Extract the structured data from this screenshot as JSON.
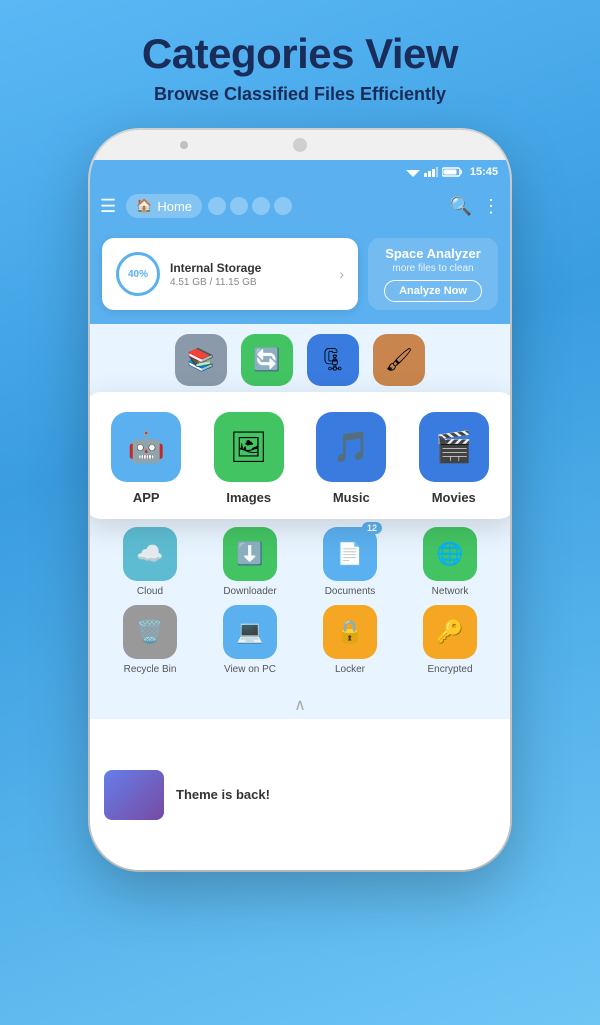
{
  "header": {
    "title": "Categories View",
    "subtitle": "Browse Classified Files Efficiently"
  },
  "statusBar": {
    "time": "15:45"
  },
  "navBar": {
    "homeLabel": "Home",
    "searchIcon": "search",
    "moreIcon": "more"
  },
  "storage": {
    "percent": "40%",
    "title": "Internal Storage",
    "size": "4.51 GB / 11.15 GB",
    "analyzer": {
      "title": "Space Analyzer",
      "subtitle": "more files to clean",
      "buttonLabel": "Analyze Now"
    }
  },
  "popupCategories": [
    {
      "label": "APP",
      "color": "#5bb0ef",
      "icon": "🤖"
    },
    {
      "label": "Images",
      "color": "#43c463",
      "icon": "🖼️"
    },
    {
      "label": "Music",
      "color": "#5bb0ef",
      "icon": "🎵"
    },
    {
      "label": "Movies",
      "color": "#5bb0ef",
      "icon": "🎬"
    }
  ],
  "bottomCategories": {
    "row1": [
      {
        "label": "Cloud",
        "color": "#5dbcd2",
        "icon": "☁️"
      },
      {
        "label": "Downloader",
        "color": "#43c463",
        "icon": "⬇️"
      },
      {
        "label": "Documents",
        "color": "#5bb0ef",
        "icon": "📄",
        "badge": "12"
      },
      {
        "label": "Network",
        "color": "#43c463",
        "icon": "🌐"
      }
    ],
    "row2": [
      {
        "label": "Recycle Bin",
        "color": "#999",
        "icon": "🗑️"
      },
      {
        "label": "View on PC",
        "color": "#5bb0ef",
        "icon": "🖥️"
      },
      {
        "label": "Locker",
        "color": "#f5a623",
        "icon": "🔒"
      },
      {
        "label": "Encrypted",
        "color": "#f5a623",
        "icon": "🔑"
      }
    ]
  },
  "topPartialIcons": [
    {
      "color": "#8a9aaa",
      "icon": "📚"
    },
    {
      "color": "#43c463",
      "icon": "🔄"
    },
    {
      "color": "#5bb0ef",
      "icon": "🗜️"
    },
    {
      "color": "#b8864e",
      "icon": "🖌️"
    }
  ],
  "banner": {
    "text": "Theme is back!"
  }
}
